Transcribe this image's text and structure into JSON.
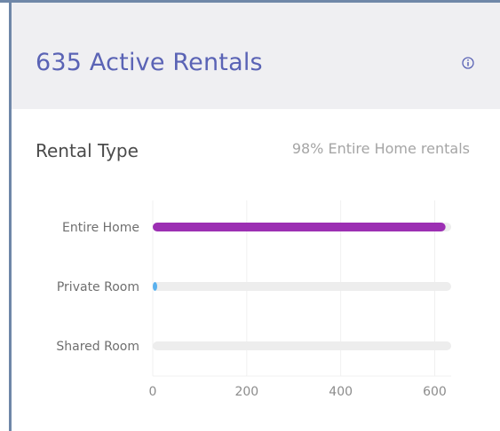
{
  "header": {
    "title": "635 Active Rentals",
    "info_icon": "info-circle-icon",
    "accent_color": "#5a63b5"
  },
  "section": {
    "title": "Rental Type",
    "summary": "98% Entire Home rentals"
  },
  "chart_data": {
    "type": "bar",
    "orientation": "horizontal",
    "categories": [
      "Entire Home",
      "Private Room",
      "Shared Room"
    ],
    "values": [
      623,
      1,
      0
    ],
    "colors": [
      "#9c2fb3",
      "#5ab1ee",
      "#e4e4e4"
    ],
    "track_color": "#ededed",
    "xlim": [
      0,
      635
    ],
    "xticks": [
      0,
      200,
      400,
      600
    ],
    "xtick_labels": [
      "0",
      "200",
      "400",
      "600"
    ],
    "grid": true,
    "title": "",
    "xlabel": "",
    "ylabel": ""
  }
}
